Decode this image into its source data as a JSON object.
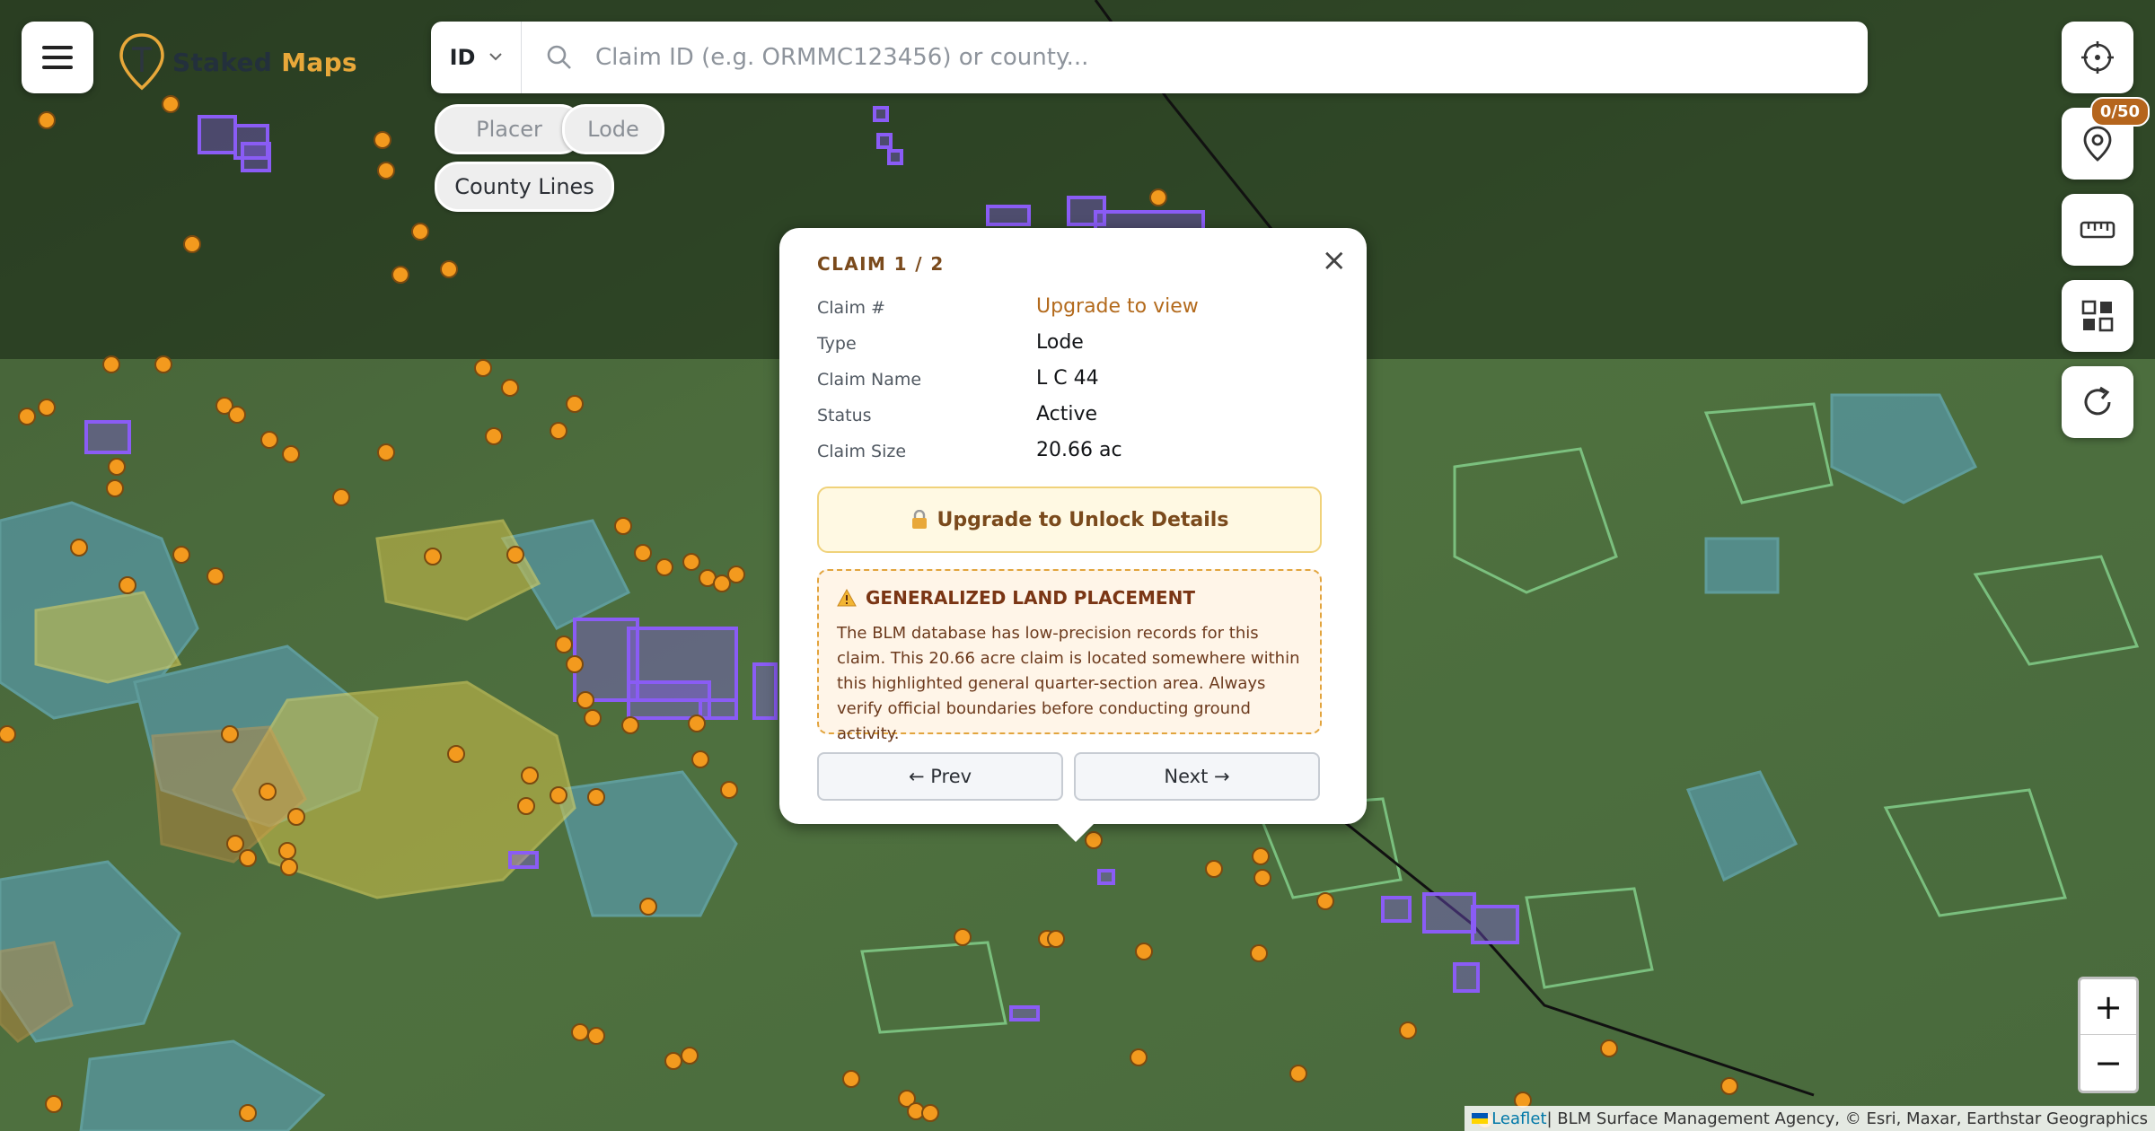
{
  "app": {
    "logo_word1": "Staked",
    "logo_word2": "Maps"
  },
  "search": {
    "state": "ID",
    "placeholder": "Claim ID (e.g. ORMMC123456) or county..."
  },
  "filters": [
    {
      "label": "Placer",
      "active": false
    },
    {
      "label": "Lode",
      "active": false
    },
    {
      "label": "County Lines",
      "active": true
    }
  ],
  "side_tools": {
    "saved_badge": "0/50"
  },
  "popup": {
    "title": "CLAIM 1 / 2",
    "fields": [
      {
        "label": "Claim #",
        "value": "Upgrade to view",
        "is_link": true
      },
      {
        "label": "Type",
        "value": "Lode"
      },
      {
        "label": "Claim Name",
        "value": "L C 44"
      },
      {
        "label": "Status",
        "value": "Active"
      },
      {
        "label": "Claim Size",
        "value": "20.66 ac"
      }
    ],
    "upgrade_label": "Upgrade to Unlock Details",
    "warning_title": "GENERALIZED LAND PLACEMENT",
    "warning_body": "The BLM database has low-precision records for this claim. This 20.66 acre claim is located somewhere within this highlighted general quarter-section area. Always verify official boundaries before conducting ground activity.",
    "prev_label": "← Prev",
    "next_label": "Next →"
  },
  "zoom": {
    "in_label": "+",
    "out_label": "−"
  },
  "attribution": {
    "leaflet": "Leaflet",
    "rest": " | BLM Surface Management Agency, © Esri, Maxar, Earthstar Geographics"
  },
  "colors": {
    "accent": "#e8a83a",
    "claim_purple": "#7c4dff",
    "marker_orange": "#f39a1e",
    "brand_dark": "#7a4a1c"
  }
}
